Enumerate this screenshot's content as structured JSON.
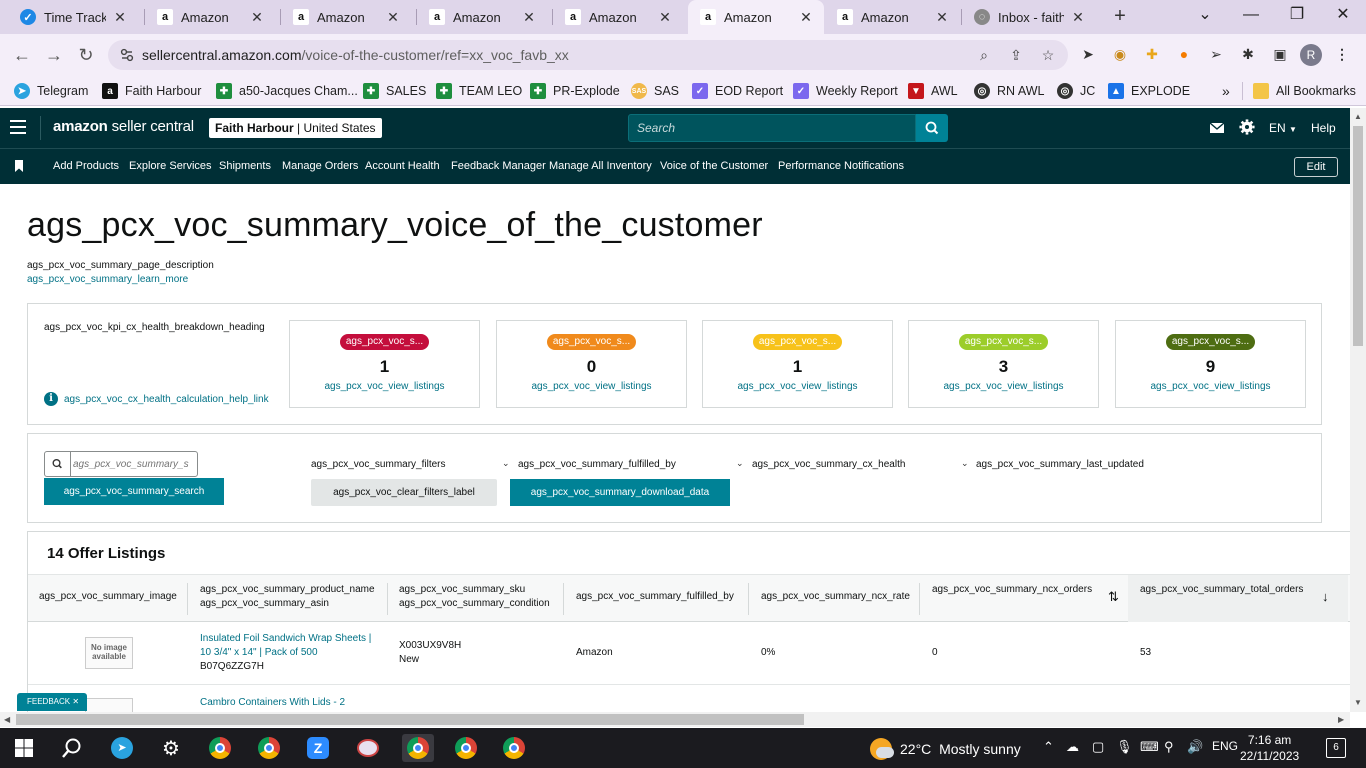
{
  "browser": {
    "tabs": [
      {
        "label": "Time Tracker",
        "icon": "time-tracker-icon"
      },
      {
        "label": "Amazon",
        "icon": "amazon-icon"
      },
      {
        "label": "Amazon",
        "icon": "amazon-icon"
      },
      {
        "label": "Amazon",
        "icon": "amazon-icon"
      },
      {
        "label": "Amazon",
        "icon": "amazon-icon"
      },
      {
        "label": "Amazon",
        "icon": "amazon-icon",
        "active": true
      },
      {
        "label": "Amazon",
        "icon": "amazon-icon"
      },
      {
        "label": "Inbox - faith",
        "icon": "gmail-icon"
      }
    ],
    "url_host": "sellercentral.amazon.com",
    "url_path": "/voice-of-the-customer/ref=xx_voc_favb_xx",
    "profile_initial": "R",
    "bookmarks": [
      {
        "label": "Telegram",
        "icon": "telegram-icon",
        "color": "#2aa3df"
      },
      {
        "label": "Faith Harbour",
        "icon": "amazon-icon",
        "color": "#111111"
      },
      {
        "label": "a50-Jacques Cham...",
        "icon": "sheets-icon",
        "color": "#1e8e3e"
      },
      {
        "label": "SALES",
        "icon": "sheets-icon",
        "color": "#1e8e3e"
      },
      {
        "label": "TEAM LEO",
        "icon": "sheets-icon",
        "color": "#1e8e3e"
      },
      {
        "label": "PR-Explode",
        "icon": "sheets-icon",
        "color": "#1e8e3e"
      },
      {
        "label": "SAS",
        "icon": "sas-icon",
        "color": "#f0b84a"
      },
      {
        "label": "EOD Report",
        "icon": "clickup-icon",
        "color": "#7b68ee"
      },
      {
        "label": "Weekly Report",
        "icon": "clickup-icon",
        "color": "#7b68ee"
      },
      {
        "label": "AWL",
        "icon": "awl-icon",
        "color": "#c4161c"
      },
      {
        "label": "RN AWL",
        "icon": "globe-icon",
        "color": "#333333"
      },
      {
        "label": "JC",
        "icon": "globe-icon",
        "color": "#333333"
      },
      {
        "label": "EXPLODE",
        "icon": "drive-icon",
        "color": "#1a73e8"
      }
    ],
    "all_bookmarks": "All Bookmarks"
  },
  "header": {
    "logo_brand": "amazon",
    "logo_product": "seller central",
    "store_name": "Faith Harbour",
    "store_region": "United States",
    "search_placeholder": "Search",
    "language": "EN",
    "help": "Help"
  },
  "nav": {
    "items": [
      "Add Products",
      "Explore Services",
      "Shipments",
      "Manage Orders",
      "Account Health",
      "Feedback Manager",
      "Manage All Inventory",
      "Voice of the Customer",
      "Performance Notifications"
    ],
    "edit": "Edit"
  },
  "page": {
    "title": "ags_pcx_voc_summary_voice_of_the_customer",
    "description": "ags_pcx_voc_summary_page_description",
    "learn_more": "ags_pcx_voc_summary_learn_more"
  },
  "kpi": {
    "heading": "ags_pcx_voc_kpi_cx_health_breakdown_heading",
    "help_link": "ags_pcx_voc_cx_health_calculation_help_link",
    "tiles": [
      {
        "badge": "ags_pcx_voc_s...",
        "count": "1",
        "link": "ags_pcx_voc_view_listings",
        "color": "#c40e3c"
      },
      {
        "badge": "ags_pcx_voc_s...",
        "count": "0",
        "link": "ags_pcx_voc_view_listings",
        "color": "#f08a1c"
      },
      {
        "badge": "ags_pcx_voc_s...",
        "count": "1",
        "link": "ags_pcx_voc_view_listings",
        "color": "#f7c21a"
      },
      {
        "badge": "ags_pcx_voc_s...",
        "count": "3",
        "link": "ags_pcx_voc_view_listings",
        "color": "#9ccd2a"
      },
      {
        "badge": "ags_pcx_voc_s...",
        "count": "9",
        "link": "ags_pcx_voc_view_listings",
        "color": "#4e6d12"
      }
    ]
  },
  "filters": {
    "search_placeholder": "ags_pcx_voc_summary_s",
    "search_button": "ags_pcx_voc_summary_search",
    "filters_label": "ags_pcx_voc_summary_filters",
    "fulfilled_by": "ags_pcx_voc_summary_fulfilled_by",
    "cx_health": "ags_pcx_voc_summary_cx_health",
    "last_updated": "ags_pcx_voc_summary_last_updated",
    "clear": "ags_pcx_voc_clear_filters_label",
    "download": "ags_pcx_voc_summary_download_data"
  },
  "listings": {
    "title": "14 Offer Listings",
    "columns": {
      "image": "ags_pcx_voc_summary_image",
      "product_name": "ags_pcx_voc_summary_product_name",
      "asin": "ags_pcx_voc_summary_asin",
      "sku": "ags_pcx_voc_summary_sku",
      "condition": "ags_pcx_voc_summary_condition",
      "fulfilled_by": "ags_pcx_voc_summary_fulfilled_by",
      "ncx_rate": "ags_pcx_voc_summary_ncx_rate",
      "ncx_orders": "ags_pcx_voc_summary_ncx_orders",
      "total_orders": "ags_pcx_voc_summary_total_orders"
    },
    "rows": [
      {
        "image_text": "No image available",
        "product_line1": "Insulated Foil Sandwich Wrap Sheets |",
        "product_line2": "10 3/4\" x 14\" | Pack of 500",
        "asin": "B07Q6ZZG7H",
        "sku": "X003UX9V8H",
        "condition": "New",
        "fulfilled_by": "Amazon",
        "ncx_rate": "0%",
        "ncx_orders": "0",
        "total_orders": "53"
      },
      {
        "product_line1": "Cambro Containers With Lids - 2"
      }
    ]
  },
  "feedback": "FEEDBACK",
  "taskbar": {
    "weather_temp": "22°C",
    "weather_text": "Mostly sunny",
    "lang": "ENG",
    "time": "7:16 am",
    "date": "22/11/2023",
    "notifications": "6"
  }
}
